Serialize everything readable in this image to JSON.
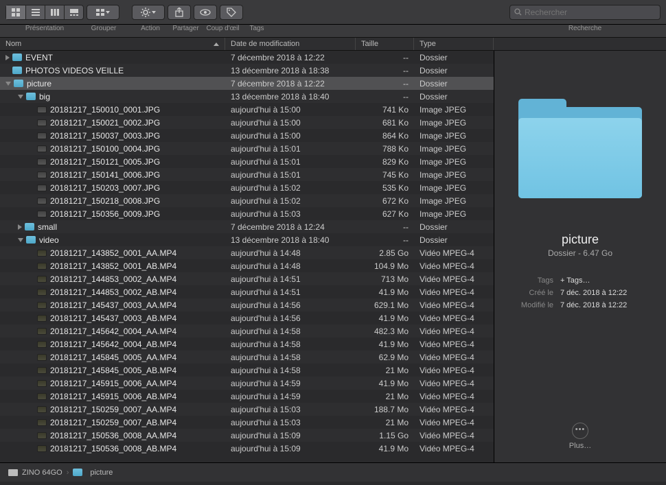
{
  "toolbar": {
    "labels": {
      "presentation": "Présentation",
      "grouper": "Grouper",
      "action": "Action",
      "partager": "Partager",
      "coupdoeil": "Coup d'œil",
      "tags": "Tags",
      "recherche": "Recherche"
    },
    "search_placeholder": "Rechercher"
  },
  "columns": {
    "name": "Nom",
    "modified": "Date de modification",
    "size": "Taille",
    "type": "Type"
  },
  "rows": [
    {
      "depth": 0,
      "disclosure": "closed",
      "icon": "folder",
      "name": "EVENT",
      "mod": "7 décembre 2018 à 12:22",
      "size": "--",
      "type": "Dossier"
    },
    {
      "depth": 0,
      "disclosure": "none",
      "icon": "folder",
      "name": "PHOTOS VIDEOS VEILLE",
      "mod": "13 décembre 2018 à 18:38",
      "size": "--",
      "type": "Dossier"
    },
    {
      "depth": 0,
      "disclosure": "open",
      "icon": "folder",
      "name": "picture",
      "mod": "7 décembre 2018 à 12:22",
      "size": "--",
      "type": "Dossier",
      "selected": true
    },
    {
      "depth": 1,
      "disclosure": "open",
      "icon": "folder",
      "name": "big",
      "mod": "13 décembre 2018 à 18:40",
      "size": "--",
      "type": "Dossier"
    },
    {
      "depth": 2,
      "disclosure": "none",
      "icon": "jpeg",
      "name": "20181217_150010_0001.JPG",
      "mod": "aujourd'hui à 15:00",
      "size": "741 Ko",
      "type": "Image JPEG"
    },
    {
      "depth": 2,
      "disclosure": "none",
      "icon": "jpeg",
      "name": "20181217_150021_0002.JPG",
      "mod": "aujourd'hui à 15:00",
      "size": "681 Ko",
      "type": "Image JPEG"
    },
    {
      "depth": 2,
      "disclosure": "none",
      "icon": "jpeg",
      "name": "20181217_150037_0003.JPG",
      "mod": "aujourd'hui à 15:00",
      "size": "864 Ko",
      "type": "Image JPEG"
    },
    {
      "depth": 2,
      "disclosure": "none",
      "icon": "jpeg",
      "name": "20181217_150100_0004.JPG",
      "mod": "aujourd'hui à 15:01",
      "size": "788 Ko",
      "type": "Image JPEG"
    },
    {
      "depth": 2,
      "disclosure": "none",
      "icon": "jpeg",
      "name": "20181217_150121_0005.JPG",
      "mod": "aujourd'hui à 15:01",
      "size": "829 Ko",
      "type": "Image JPEG"
    },
    {
      "depth": 2,
      "disclosure": "none",
      "icon": "jpeg",
      "name": "20181217_150141_0006.JPG",
      "mod": "aujourd'hui à 15:01",
      "size": "745 Ko",
      "type": "Image JPEG"
    },
    {
      "depth": 2,
      "disclosure": "none",
      "icon": "jpeg",
      "name": "20181217_150203_0007.JPG",
      "mod": "aujourd'hui à 15:02",
      "size": "535 Ko",
      "type": "Image JPEG"
    },
    {
      "depth": 2,
      "disclosure": "none",
      "icon": "jpeg",
      "name": "20181217_150218_0008.JPG",
      "mod": "aujourd'hui à 15:02",
      "size": "672 Ko",
      "type": "Image JPEG"
    },
    {
      "depth": 2,
      "disclosure": "none",
      "icon": "jpeg",
      "name": "20181217_150356_0009.JPG",
      "mod": "aujourd'hui à 15:03",
      "size": "627 Ko",
      "type": "Image JPEG"
    },
    {
      "depth": 1,
      "disclosure": "closed",
      "icon": "folder",
      "name": "small",
      "mod": "7 décembre 2018 à 12:24",
      "size": "--",
      "type": "Dossier"
    },
    {
      "depth": 1,
      "disclosure": "open",
      "icon": "folder",
      "name": "video",
      "mod": "13 décembre 2018 à 18:40",
      "size": "--",
      "type": "Dossier"
    },
    {
      "depth": 2,
      "disclosure": "none",
      "icon": "video",
      "name": "20181217_143852_0001_AA.MP4",
      "mod": "aujourd'hui à 14:48",
      "size": "2.85 Go",
      "type": "Vidéo MPEG-4"
    },
    {
      "depth": 2,
      "disclosure": "none",
      "icon": "video",
      "name": "20181217_143852_0001_AB.MP4",
      "mod": "aujourd'hui à 14:48",
      "size": "104.9 Mo",
      "type": "Vidéo MPEG-4"
    },
    {
      "depth": 2,
      "disclosure": "none",
      "icon": "video",
      "name": "20181217_144853_0002_AA.MP4",
      "mod": "aujourd'hui à 14:51",
      "size": "713 Mo",
      "type": "Vidéo MPEG-4"
    },
    {
      "depth": 2,
      "disclosure": "none",
      "icon": "video",
      "name": "20181217_144853_0002_AB.MP4",
      "mod": "aujourd'hui à 14:51",
      "size": "41.9 Mo",
      "type": "Vidéo MPEG-4"
    },
    {
      "depth": 2,
      "disclosure": "none",
      "icon": "video",
      "name": "20181217_145437_0003_AA.MP4",
      "mod": "aujourd'hui à 14:56",
      "size": "629.1 Mo",
      "type": "Vidéo MPEG-4"
    },
    {
      "depth": 2,
      "disclosure": "none",
      "icon": "video",
      "name": "20181217_145437_0003_AB.MP4",
      "mod": "aujourd'hui à 14:56",
      "size": "41.9 Mo",
      "type": "Vidéo MPEG-4"
    },
    {
      "depth": 2,
      "disclosure": "none",
      "icon": "video",
      "name": "20181217_145642_0004_AA.MP4",
      "mod": "aujourd'hui à 14:58",
      "size": "482.3 Mo",
      "type": "Vidéo MPEG-4"
    },
    {
      "depth": 2,
      "disclosure": "none",
      "icon": "video",
      "name": "20181217_145642_0004_AB.MP4",
      "mod": "aujourd'hui à 14:58",
      "size": "41.9 Mo",
      "type": "Vidéo MPEG-4"
    },
    {
      "depth": 2,
      "disclosure": "none",
      "icon": "video",
      "name": "20181217_145845_0005_AA.MP4",
      "mod": "aujourd'hui à 14:58",
      "size": "62.9 Mo",
      "type": "Vidéo MPEG-4"
    },
    {
      "depth": 2,
      "disclosure": "none",
      "icon": "video",
      "name": "20181217_145845_0005_AB.MP4",
      "mod": "aujourd'hui à 14:58",
      "size": "21 Mo",
      "type": "Vidéo MPEG-4"
    },
    {
      "depth": 2,
      "disclosure": "none",
      "icon": "video",
      "name": "20181217_145915_0006_AA.MP4",
      "mod": "aujourd'hui à 14:59",
      "size": "41.9 Mo",
      "type": "Vidéo MPEG-4"
    },
    {
      "depth": 2,
      "disclosure": "none",
      "icon": "video",
      "name": "20181217_145915_0006_AB.MP4",
      "mod": "aujourd'hui à 14:59",
      "size": "21 Mo",
      "type": "Vidéo MPEG-4"
    },
    {
      "depth": 2,
      "disclosure": "none",
      "icon": "video",
      "name": "20181217_150259_0007_AA.MP4",
      "mod": "aujourd'hui à 15:03",
      "size": "188.7 Mo",
      "type": "Vidéo MPEG-4"
    },
    {
      "depth": 2,
      "disclosure": "none",
      "icon": "video",
      "name": "20181217_150259_0007_AB.MP4",
      "mod": "aujourd'hui à 15:03",
      "size": "21 Mo",
      "type": "Vidéo MPEG-4"
    },
    {
      "depth": 2,
      "disclosure": "none",
      "icon": "video",
      "name": "20181217_150536_0008_AA.MP4",
      "mod": "aujourd'hui à 15:09",
      "size": "1.15 Go",
      "type": "Vidéo MPEG-4"
    },
    {
      "depth": 2,
      "disclosure": "none",
      "icon": "video",
      "name": "20181217_150536_0008_AB.MP4",
      "mod": "aujourd'hui à 15:09",
      "size": "41.9 Mo",
      "type": "Vidéo MPEG-4"
    }
  ],
  "preview": {
    "title": "picture",
    "subtitle": "Dossier - 6.47 Go",
    "meta": {
      "tags_label": "Tags",
      "tags_value": "+ Tags…",
      "created_label": "Créé le",
      "created_value": "7 déc. 2018 à 12:22",
      "modified_label": "Modifié le",
      "modified_value": "7 déc. 2018 à 12:22"
    },
    "more": "Plus…"
  },
  "path": {
    "root": "ZINO 64GO",
    "sep": "›",
    "leaf": "picture"
  }
}
